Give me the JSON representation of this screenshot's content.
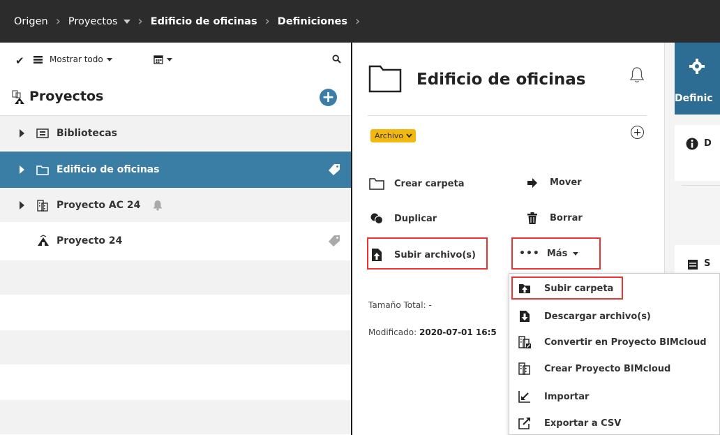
{
  "breadcrumb": {
    "items": [
      "Origen",
      "Proyectos",
      "Edificio de oficinas",
      "Definiciones"
    ]
  },
  "left": {
    "toolbar": {
      "show_all": "Mostrar todo"
    },
    "title": "Proyectos",
    "rows": [
      {
        "label": "Bibliotecas",
        "icon": "library-icon"
      },
      {
        "label": "Edificio de oficinas",
        "icon": "folder-icon",
        "selected": true
      },
      {
        "label": "Proyecto AC 24",
        "icon": "building-icon"
      },
      {
        "label": "Proyecto 24",
        "icon": "archicad-icon"
      }
    ]
  },
  "middle": {
    "title": "Edificio de oficinas",
    "badge": "Archivo",
    "actions": {
      "create_folder": "Crear carpeta",
      "move": "Mover",
      "duplicate": "Duplicar",
      "delete": "Borrar",
      "upload_files": "Subir archivo(s)",
      "more": "Más"
    },
    "info": {
      "size_label": "Tamaño Total:",
      "size_value": "-",
      "modified_label": "Modificado:",
      "modified_value": "2020-07-01 16:5"
    }
  },
  "right": {
    "tab_label": "Definic"
  },
  "menu": {
    "items": [
      "Subir carpeta",
      "Descargar archivo(s)",
      "Convertir en Proyecto BIMcloud",
      "Crear Proyecto BIMcloud",
      "Importar",
      "Exportar a CSV"
    ]
  },
  "colors": {
    "topbar": "#2c2c2c",
    "selected_row": "#3a7ea6",
    "accent": "#3b7da8",
    "badge": "#f2b80f",
    "highlight": "#ee3333"
  }
}
